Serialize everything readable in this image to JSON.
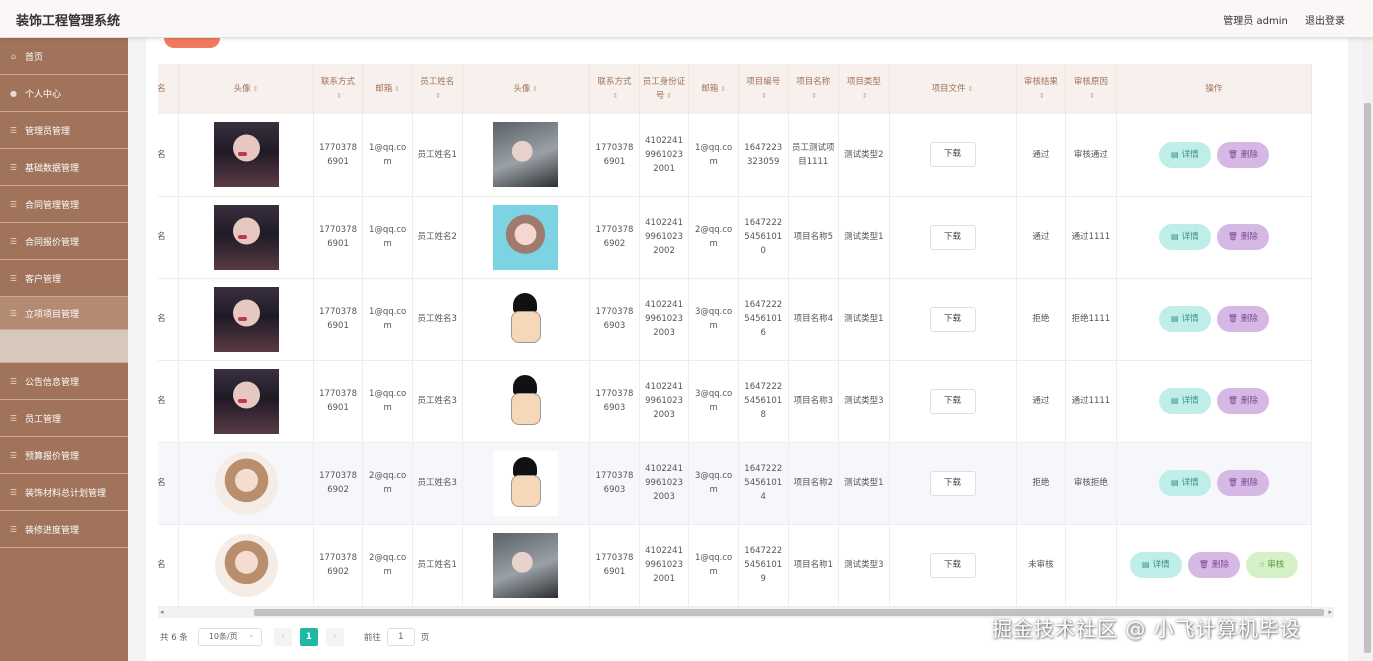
{
  "app": {
    "title": "装饰工程管理系统"
  },
  "header": {
    "user_label": "管理员 admin",
    "logout_label": "退出登录"
  },
  "sidebar": {
    "items": [
      {
        "label": "首页",
        "icon": "home-icon"
      },
      {
        "label": "个人中心",
        "icon": "user-icon"
      },
      {
        "label": "管理员管理",
        "icon": "list-icon"
      },
      {
        "label": "基础数据管理",
        "icon": "list-icon"
      },
      {
        "label": "合同管理管理",
        "icon": "list-icon"
      },
      {
        "label": "合同报价管理",
        "icon": "list-icon"
      },
      {
        "label": "客户管理",
        "icon": "list-icon"
      },
      {
        "label": "立项项目管理",
        "icon": "list-icon"
      },
      {
        "label": "公告信息管理",
        "icon": "list-icon"
      },
      {
        "label": "员工管理",
        "icon": "list-icon"
      },
      {
        "label": "预算报价管理",
        "icon": "list-icon"
      },
      {
        "label": "装饰材料总计划管理",
        "icon": "list-icon"
      },
      {
        "label": "装修进度管理",
        "icon": "list-icon"
      }
    ]
  },
  "table": {
    "headers": [
      "姓名",
      "头像",
      "联系方式",
      "邮箱",
      "员工姓名",
      "头像",
      "联系方式",
      "员工身份证号",
      "邮箱",
      "项目编号",
      "项目名称",
      "项目类型",
      "项目文件",
      "审核结果",
      "审核原因",
      "操作"
    ],
    "download_label": "下载",
    "detail_label": "详情",
    "delete_label": "删除",
    "review_label": "审核",
    "rows": [
      {
        "name": "姓名",
        "avatar1": "a",
        "phone1": "17703786901",
        "email1": "1@qq.com",
        "emp": "员工姓名1",
        "avatar2": "c",
        "phone2": "17703786901",
        "idcard": "410224199610232001",
        "email2": "1@qq.com",
        "proj_no": "1647223323059",
        "proj_name": "员工测试项目1111",
        "proj_type": "测试类型2",
        "result": "通过",
        "reason": "审核通过",
        "review": false
      },
      {
        "name": "姓名",
        "avatar1": "a",
        "phone1": "17703786901",
        "email1": "1@qq.com",
        "emp": "员工姓名2",
        "avatar2": "d",
        "phone2": "17703786902",
        "idcard": "410224199610232002",
        "email2": "2@qq.com",
        "proj_no": "16472225456101 0",
        "proj_name": "项目名称5",
        "proj_type": "测试类型1",
        "result": "通过",
        "reason": "通过1111",
        "review": false
      },
      {
        "name": "姓名",
        "avatar1": "a",
        "phone1": "17703786901",
        "email1": "1@qq.com",
        "emp": "员工姓名3",
        "avatar2": "e",
        "phone2": "17703786903",
        "idcard": "410224199610232003",
        "email2": "3@qq.com",
        "proj_no": "16472225456101 6",
        "proj_name": "项目名称4",
        "proj_type": "测试类型1",
        "result": "拒绝",
        "reason": "拒绝1111",
        "review": false
      },
      {
        "name": "姓名",
        "avatar1": "a",
        "phone1": "17703786901",
        "email1": "1@qq.com",
        "emp": "员工姓名3",
        "avatar2": "e",
        "phone2": "17703786903",
        "idcard": "410224199610232003",
        "email2": "3@qq.com",
        "proj_no": "16472225456101 8",
        "proj_name": "项目名称3",
        "proj_type": "测试类型3",
        "result": "通过",
        "reason": "通过1111",
        "review": false
      },
      {
        "name": "姓名",
        "avatar1": "b",
        "phone1": "17703786902",
        "email1": "2@qq.com",
        "emp": "员工姓名3",
        "avatar2": "e",
        "phone2": "17703786903",
        "idcard": "410224199610232003",
        "email2": "3@qq.com",
        "proj_no": "16472225456101 4",
        "proj_name": "项目名称2",
        "proj_type": "测试类型1",
        "result": "拒绝",
        "reason": "审核拒绝",
        "review": false
      },
      {
        "name": "姓名",
        "avatar1": "b",
        "phone1": "17703786902",
        "email1": "2@qq.com",
        "emp": "员工姓名1",
        "avatar2": "c",
        "phone2": "17703786901",
        "idcard": "410224199610232001",
        "email2": "1@qq.com",
        "proj_no": "16472225456101 9",
        "proj_name": "项目名称1",
        "proj_type": "测试类型3",
        "result": "未审核",
        "reason": "",
        "review": true
      }
    ]
  },
  "pagination": {
    "total": "共 6 条",
    "page_size": "10条/页",
    "current": "1",
    "goto_label": "前往",
    "goto_value": "1",
    "page_suffix": "页",
    "prev": "‹",
    "next": "›"
  },
  "watermark": "掘金技术社区 @ 小飞计算机毕设"
}
